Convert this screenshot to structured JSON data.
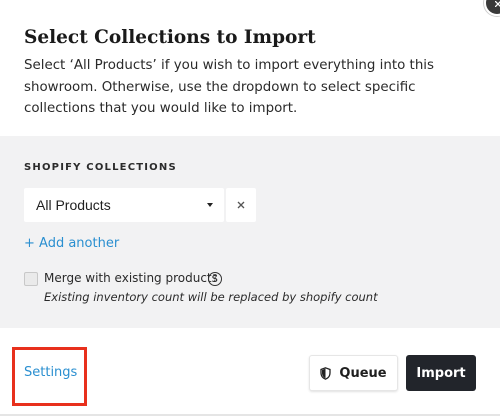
{
  "modal": {
    "title": "Select Collections to Import",
    "description": "Select ‘All Products’ if you wish to import everything into this showroom. Otherwise, use the dropdown to select specific collections that you would like to import."
  },
  "collections": {
    "section_label": "SHOPIFY COLLECTIONS",
    "selected_value": "All Products",
    "remove_glyph": "×",
    "add_another_label": "+ Add another"
  },
  "merge": {
    "checked": false,
    "label": "Merge with existing products",
    "help_glyph": "?",
    "note": "Existing inventory count will be replaced by shopify count"
  },
  "footer": {
    "settings_label": "Settings",
    "queue_label": "Queue",
    "import_label": "Import"
  },
  "icons": {
    "close": "close-icon",
    "caret": "caret-down-icon",
    "remove": "close-x-icon",
    "help": "question-circle-icon",
    "queue": "shield-icon"
  },
  "colors": {
    "link": "#2a8fd0",
    "primary_button": "#22252b",
    "highlight_box": "#e8301c",
    "panel_background": "#f2f2f3"
  }
}
